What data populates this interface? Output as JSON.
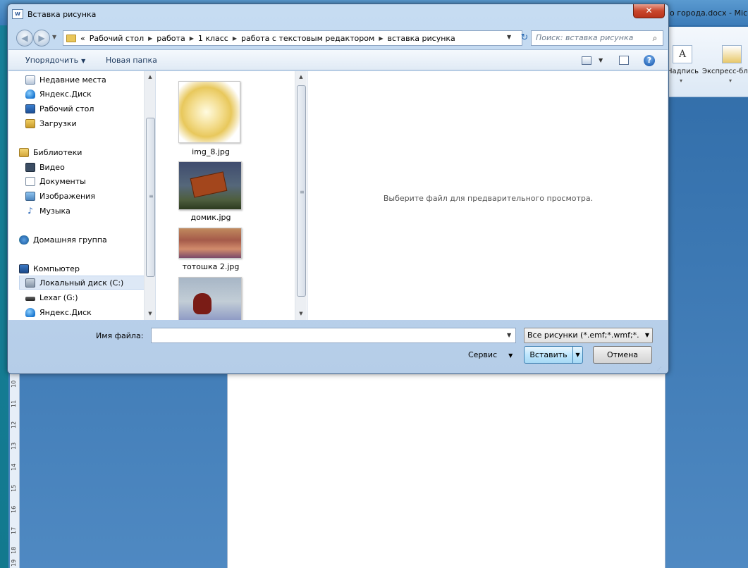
{
  "background": {
    "word_title": "о города.docx - Mic",
    "ribbon": {
      "textbox_icon_glyph": "A",
      "textbox_label": "Надпись",
      "quickparts_label": "Экспресс-бло"
    },
    "ruler_marks": [
      "10",
      "11",
      "12",
      "13",
      "14",
      "15",
      "16",
      "17",
      "18",
      "19"
    ]
  },
  "dialog": {
    "title": "Вставка рисунка",
    "close_glyph": "✕",
    "address": {
      "overflow": "«",
      "crumbs": [
        "Рабочий стол",
        "работа",
        "1 класс",
        "работа с текстовым редактором",
        "вставка рисунка"
      ]
    },
    "search": {
      "placeholder": "Поиск: вставка рисунка"
    },
    "toolbar": {
      "organize": "Упорядочить",
      "new_folder": "Новая папка",
      "help_glyph": "?"
    },
    "nav_items": [
      {
        "label": "Недавние места",
        "icon": "recent-places-icon"
      },
      {
        "label": "Яндекс.Диск",
        "icon": "yandex-disk-icon"
      },
      {
        "label": "Рабочий стол",
        "icon": "desktop-icon"
      },
      {
        "label": "Загрузки",
        "icon": "downloads-icon"
      },
      {
        "label": "Библиотеки",
        "icon": "libraries-icon"
      },
      {
        "label": "Видео",
        "icon": "video-icon"
      },
      {
        "label": "Документы",
        "icon": "documents-icon"
      },
      {
        "label": "Изображения",
        "icon": "images-icon"
      },
      {
        "label": "Музыка",
        "icon": "music-icon"
      },
      {
        "label": "Домашняя группа",
        "icon": "homegroup-icon"
      },
      {
        "label": "Компьютер",
        "icon": "computer-icon"
      },
      {
        "label": "Локальный диск (C:)",
        "icon": "local-disk-icon",
        "selected": true
      },
      {
        "label": "Lexar (G:)",
        "icon": "usb-drive-icon"
      },
      {
        "label": "Яндекс.Диск",
        "icon": "yandex-disk-icon"
      }
    ],
    "files": [
      {
        "name": "img_8.jpg"
      },
      {
        "name": "домик.jpg"
      },
      {
        "name": "тотошка 2.jpg"
      },
      {
        "name": ""
      }
    ],
    "preview_message": "Выберите файл для предварительного просмотра.",
    "bottom": {
      "filename_label": "Имя файла:",
      "filename_value": "",
      "filetype_selected": "Все рисунки (*.emf;*.wmf;*.jpg",
      "service_label": "Сервис",
      "insert_label": "Вставить",
      "cancel_label": "Отмена"
    }
  },
  "colors": {
    "accent": "#3c7fb1",
    "close_button": "#c9462c",
    "dialog_frame": "#c6dcf2"
  }
}
